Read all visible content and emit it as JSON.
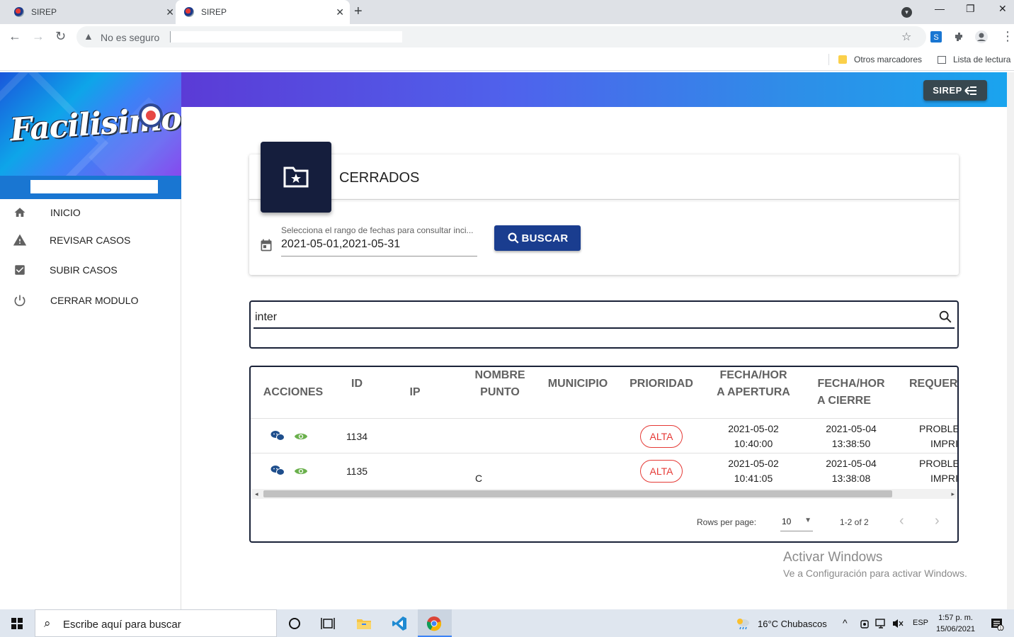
{
  "browser": {
    "tabs": [
      {
        "title": "SIREP",
        "active": false
      },
      {
        "title": "SIREP",
        "active": true
      }
    ],
    "security_label": "No es seguro",
    "bookmarks": [
      "Otros marcadores",
      "Lista de lectura"
    ]
  },
  "sidebar": {
    "logo_text": "Facilisimo",
    "items": [
      {
        "label": "INICIO",
        "icon": "home-icon"
      },
      {
        "label": "REVISAR CASOS",
        "icon": "warning-icon"
      },
      {
        "label": "SUBIR CASOS",
        "icon": "checkbox-icon"
      },
      {
        "label": "CERRAR MODULO",
        "icon": "power-icon"
      }
    ]
  },
  "header": {
    "button_label": "SIREP",
    "colors": {
      "start": "#5b3bd6",
      "end": "#1aa4ee"
    }
  },
  "card": {
    "title": "CERRADOS",
    "icon": "folder-star-icon"
  },
  "date_filter": {
    "label": "Selecciona el rango de fechas para consultar inci...",
    "value": "2021-05-01,2021-05-31"
  },
  "search_button": {
    "label": "BUSCAR"
  },
  "search": {
    "value": "inter"
  },
  "table": {
    "headers": [
      {
        "line1": "ACCIONES",
        "line2": ""
      },
      {
        "line1": "ID",
        "line2": ""
      },
      {
        "line1": "IP",
        "line2": ""
      },
      {
        "line1": "NOMBRE",
        "line2": "PUNTO"
      },
      {
        "line1": "MUNICIPIO",
        "line2": ""
      },
      {
        "line1": "PRIORIDAD",
        "line2": ""
      },
      {
        "line1": "FECHA/HOR",
        "line2": "A APERTURA"
      },
      {
        "line1": "FECHA/HOR",
        "line2": "A CIERRE"
      },
      {
        "line1": "REQUER",
        "line2": ""
      }
    ],
    "rows": [
      {
        "id": "1134",
        "ip": "",
        "nombre_punto": "",
        "municipio": "",
        "prioridad": "ALTA",
        "apertura_fecha": "2021-05-02",
        "apertura_hora": "10:40:00",
        "cierre_fecha": "2021-05-04",
        "cierre_hora": "13:38:50",
        "req1": "PROBLE",
        "req2": "IMPRI"
      },
      {
        "id": "1135",
        "ip": "",
        "nombre_punto": "C",
        "municipio": "",
        "prioridad": "ALTA",
        "apertura_fecha": "2021-05-02",
        "apertura_hora": "10:41:05",
        "cierre_fecha": "2021-05-04",
        "cierre_hora": "13:38:08",
        "req1": "PROBLE",
        "req2": "IMPRI"
      }
    ],
    "footer": {
      "rows_per_page_label": "Rows per page:",
      "rows_per_page_value": "10",
      "range": "1-2 of 2"
    }
  },
  "watermark": {
    "line1": "Activar Windows",
    "line2": "Ve a Configuración para activar Windows."
  },
  "taskbar": {
    "search_placeholder": "Escribe aquí para buscar",
    "weather": "16°C  Chubascos",
    "lang": "ESP",
    "time": "1:57 p. m.",
    "date": "15/06/2021"
  }
}
